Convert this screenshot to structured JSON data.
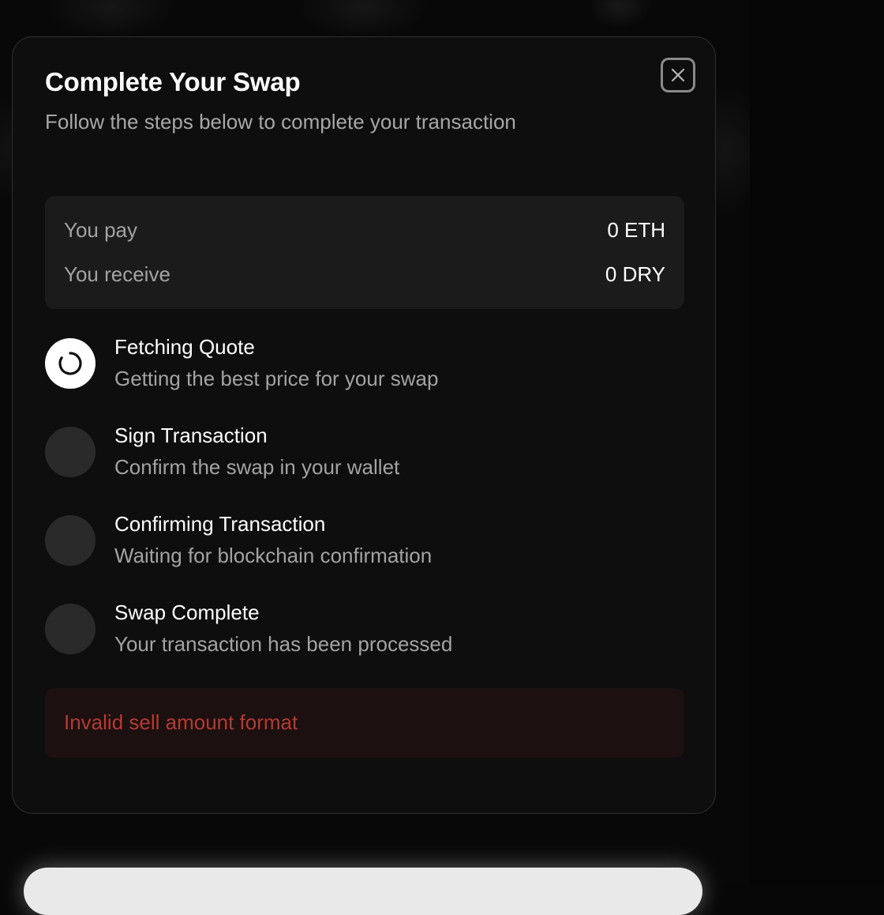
{
  "modal": {
    "title": "Complete Your Swap",
    "subtitle": "Follow the steps below to complete your transaction",
    "close_icon": "close-icon"
  },
  "summary": {
    "pay_label": "You pay",
    "pay_value": "0 ETH",
    "receive_label": "You receive",
    "receive_value": "0 DRY"
  },
  "steps": [
    {
      "title": "Fetching Quote",
      "description": "Getting the best price for your swap",
      "status": "active",
      "icon": "spinner-icon"
    },
    {
      "title": "Sign Transaction",
      "description": "Confirm the swap in your wallet",
      "status": "pending"
    },
    {
      "title": "Confirming Transaction",
      "description": "Waiting for blockchain confirmation",
      "status": "pending"
    },
    {
      "title": "Swap Complete",
      "description": "Your transaction has been processed",
      "status": "pending"
    }
  ],
  "error": {
    "message": "Invalid sell amount format"
  },
  "colors": {
    "modal_bg": "#0e0e0e",
    "summary_bg": "#1b1b1b",
    "error_text": "#b53a32",
    "error_bg": "#1c1010",
    "pending_circle": "#2a2a2a"
  }
}
